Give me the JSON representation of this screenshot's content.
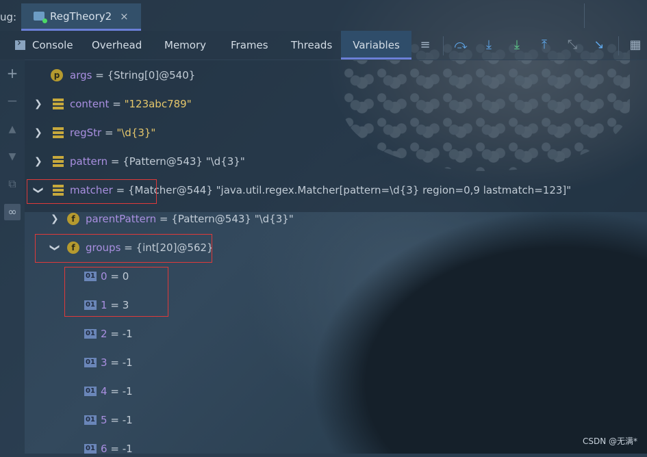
{
  "window": {
    "debug_label": "ug:",
    "run_tab_label": "RegTheory2",
    "run_tab_close": "×"
  },
  "toolbar": {
    "tabs": [
      "Console",
      "Overhead",
      "Memory",
      "Frames",
      "Threads",
      "Variables"
    ],
    "active_tab": "Variables"
  },
  "variables": [
    {
      "name": "args",
      "value": "{String[0]@540}"
    },
    {
      "name": "content",
      "value": "\"123abc789\""
    },
    {
      "name": "regStr",
      "value": "\"\\d{3}\""
    },
    {
      "name": "pattern",
      "value": "{Pattern@543} \"\\d{3}\""
    },
    {
      "name": "matcher",
      "value": "{Matcher@544} \"java.util.regex.Matcher[pattern=\\d{3} region=0,9 lastmatch=123]\""
    },
    {
      "name": "parentPattern",
      "value": "{Pattern@543} \"\\d{3}\""
    },
    {
      "name": "groups",
      "value": "{int[20]@562}"
    }
  ],
  "groups_items": [
    {
      "index": "0",
      "value": "0"
    },
    {
      "index": "1",
      "value": "3"
    },
    {
      "index": "2",
      "value": "-1"
    },
    {
      "index": "3",
      "value": "-1"
    },
    {
      "index": "4",
      "value": "-1"
    },
    {
      "index": "5",
      "value": "-1"
    },
    {
      "index": "6",
      "value": "-1"
    }
  ],
  "symbols": {
    "eq": "=",
    "p_badge": "p",
    "f_badge": "f",
    "int_badge": "01"
  },
  "watermark": "CSDN @无满*",
  "colors": {
    "accent": "#6b7fd7",
    "var_name": "#a98fe0",
    "string_value": "#e6c76b",
    "highlight_box": "#e03a3a"
  }
}
